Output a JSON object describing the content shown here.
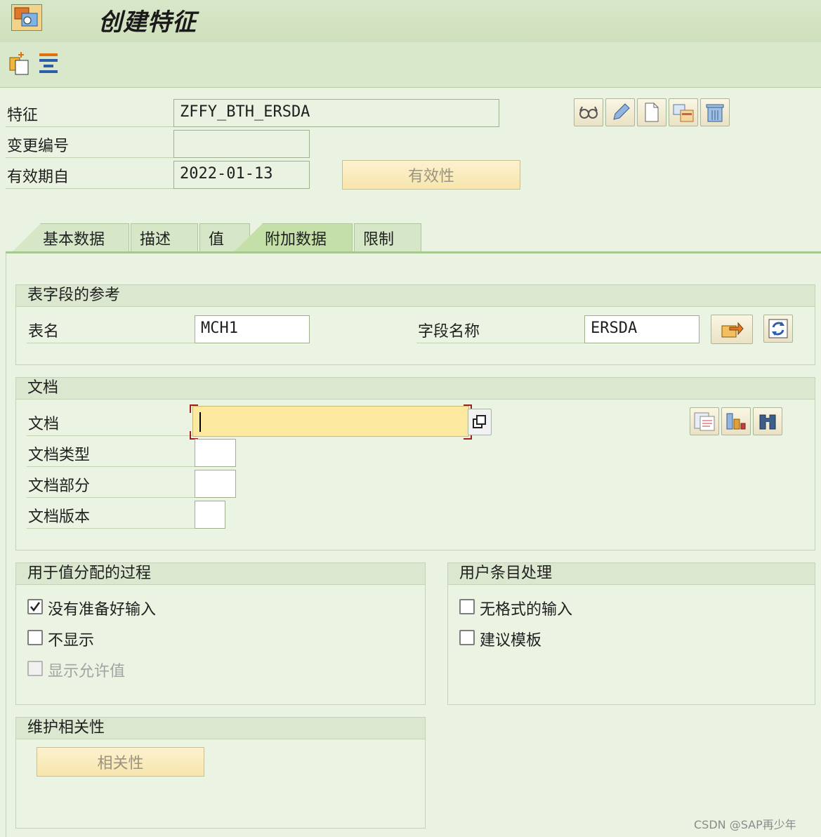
{
  "window": {
    "title": "创建特征"
  },
  "header": {
    "characteristic_label": "特征",
    "characteristic_value": "ZFFY_BTH_ERSDA",
    "change_number_label": "变更编号",
    "change_number_value": "",
    "valid_from_label": "有效期自",
    "valid_from_value": "2022-01-13",
    "validity_button": "有效性"
  },
  "tabs": [
    {
      "label": "基本数据"
    },
    {
      "label": "描述"
    },
    {
      "label": "值"
    },
    {
      "label": "附加数据"
    },
    {
      "label": "限制"
    }
  ],
  "table_ref": {
    "title": "表字段的参考",
    "table_label": "表名",
    "table_value": "MCH1",
    "field_label": "字段名称",
    "field_value": "ERSDA"
  },
  "document": {
    "title": "文档",
    "doc_label": "文档",
    "doc_value": "",
    "doc_type_label": "文档类型",
    "doc_part_label": "文档部分",
    "doc_version_label": "文档版本"
  },
  "value_assignment": {
    "title": "用于值分配的过程",
    "not_ready_label": "没有准备好输入",
    "not_ready_checked": true,
    "no_display_label": "不显示",
    "show_allowed_label": "显示允许值"
  },
  "user_entry": {
    "title": "用户条目处理",
    "unformatted_label": "无格式的输入",
    "template_label": "建议模板"
  },
  "dependencies": {
    "title": "维护相关性",
    "button": "相关性"
  },
  "watermark": "CSDN @SAP再少年"
}
